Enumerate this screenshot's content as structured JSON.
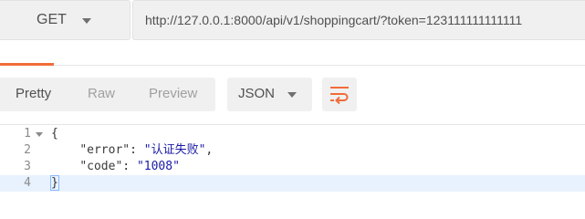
{
  "request": {
    "method": "GET",
    "url": "http://127.0.0.1:8000/api/v1/shoppingcart/?token=123111111111111"
  },
  "response_toolbar": {
    "view_tabs": [
      "Pretty",
      "Raw",
      "Preview"
    ],
    "active_view": "Pretty",
    "format": "JSON"
  },
  "code": {
    "line_numbers": [
      "1",
      "2",
      "3",
      "4"
    ],
    "open_brace": "{",
    "close_brace": "}",
    "entries": [
      {
        "key": "\"error\"",
        "value": "\"认证失败\"",
        "trail": ","
      },
      {
        "key": "\"code\"",
        "value": "\"1008\"",
        "trail": ""
      }
    ]
  },
  "colors": {
    "accent": "#f26b3a",
    "string": "#1a1aa6",
    "active_line": "#e8f2ff"
  }
}
